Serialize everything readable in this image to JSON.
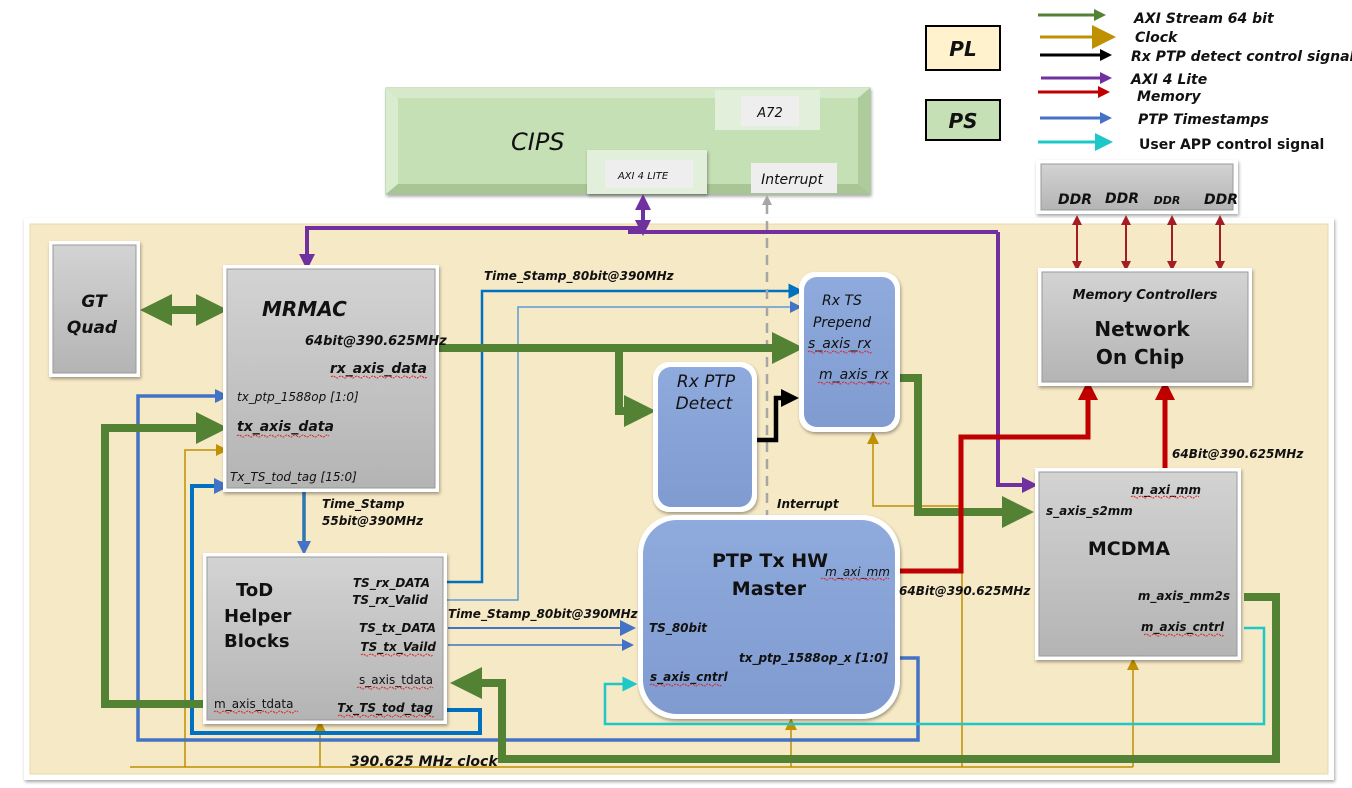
{
  "legend": {
    "items": [
      {
        "label": "AXI Stream 64 bit",
        "color": "#548235"
      },
      {
        "label": "Clock",
        "color": "#bf9000"
      },
      {
        "label": "Rx PTP detect control signal",
        "color": "#000000"
      },
      {
        "label": "AXI 4 Lite",
        "color": "#7030a0"
      },
      {
        "label": "Memory",
        "color": "#c00000"
      },
      {
        "label": "PTP Timestamps",
        "color": "#4472c4"
      },
      {
        "label": "User APP control signal",
        "color": "#1fc8c8"
      }
    ],
    "pl_label": "PL",
    "ps_label": "PS",
    "pl_color": "#fff2cc",
    "ps_color": "#c5e0b4"
  },
  "cips": {
    "title": "CIPS",
    "a72": "A72",
    "axi4lite": "AXI 4 LITE",
    "interrupt": "Interrupt"
  },
  "ddr": {
    "labels": [
      "DDR",
      "DDR",
      "DDR",
      "DDR"
    ]
  },
  "noc": {
    "subtitle": "Memory Controllers",
    "title_line1": "Network",
    "title_line2": "On Chip"
  },
  "gt_quad": {
    "line1": "GT",
    "line2": "Quad"
  },
  "mrmac": {
    "title": "MRMAC",
    "rate": "64bit@390.625MHz",
    "rx_axis_data": "rx_axis_data",
    "tx_ptp": "tx_ptp_1588op [1:0]",
    "tx_axis_data": "tx_axis_data",
    "tx_ts_tod_tag": "Tx_TS_tod_tag [15:0]"
  },
  "timestamp55": {
    "line1": "Time_Stamp",
    "line2": "55bit@390MHz"
  },
  "tod": {
    "line1": "ToD",
    "line2": "Helper",
    "line3": "Blocks",
    "ts_rx_data": "TS_rx_DATA",
    "ts_rx_valid": "TS_rx_Valid",
    "ts_tx_data": "TS_tx_DATA",
    "ts_tx_valid": "TS_tx_Vaild",
    "s_axis_tdata": "s_axis_tdata",
    "m_axis_tdata": "m_axis_tdata",
    "tx_ts_tod_tag": "Tx_TS_tod_tag"
  },
  "signals": {
    "ts80_top": "Time_Stamp_80bit@390MHz",
    "ts80_bottom": "Time_Stamp_80bit@390MHz",
    "interrupt": "Interrupt",
    "mem_rate_ptp": "64Bit@390.625MHz",
    "mem_rate_mcdma": "64Bit@390.625MHz",
    "clock": "390.625 MHz  clock"
  },
  "rx_ptp_detect": {
    "line1": "Rx PTP",
    "line2": "Detect"
  },
  "rx_ts_prepend": {
    "line1": "Rx TS",
    "line2": "Prepend",
    "s_axis_rx": "s_axis_rx",
    "m_axis_rx": "m_axis_rx"
  },
  "ptp_tx": {
    "line1": "PTP Tx HW",
    "line2": "Master",
    "m_axi_mm": "m_axi_mm",
    "ts_80bit": "TS_80bit",
    "tx_ptp": "tx_ptp_1588op_x [1:0]",
    "s_axis_cntrl": "s_axis_cntrl"
  },
  "mcdma": {
    "title": "MCDMA",
    "m_axi_mm": "m_axi_mm",
    "s_axis_s2mm": "s_axis_s2mm",
    "m_axis_mm2s": "m_axis_mm2s",
    "m_axis_cntrl": "m_axis_cntrl"
  }
}
